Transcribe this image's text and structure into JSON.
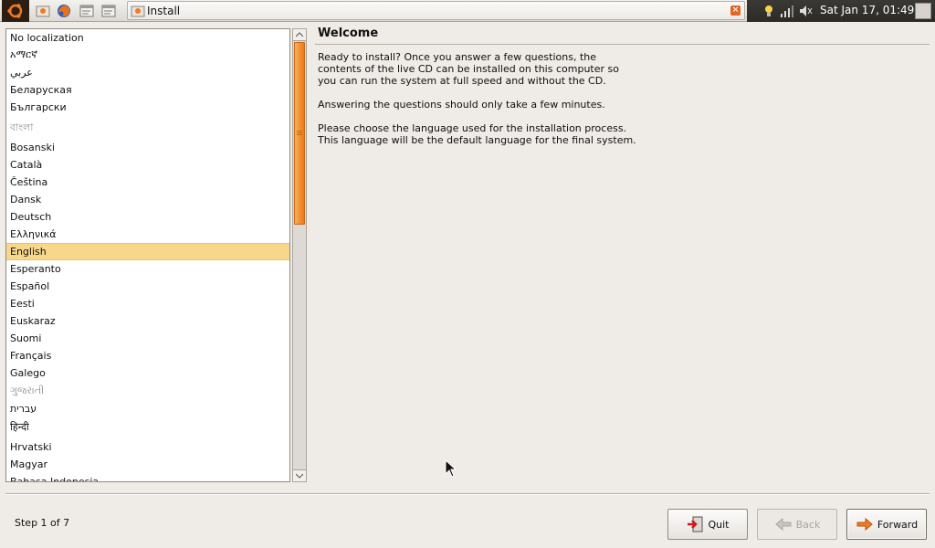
{
  "panel": {
    "window_title": "Install",
    "clock": "Sat Jan 17, 01:49"
  },
  "languages": [
    "No localization",
    "አማርኛ",
    "عربي",
    "Беларуская",
    "Български",
    "বাংলা",
    "Bosanski",
    "Català",
    "Čeština",
    "Dansk",
    "Deutsch",
    "Ελληνικά",
    "English",
    "Esperanto",
    "Español",
    "Eesti",
    "Euskaraz",
    "Suomi",
    "Français",
    "Galego",
    "ગુજરાતી",
    "עברית",
    "हिन्दी",
    "Hrvatski",
    "Magyar",
    "Bahasa Indonesia"
  ],
  "selected_language": "English",
  "welcome": {
    "title": "Welcome",
    "paragraph1": "Ready to install? Once you answer a few questions, the\ncontents of the live CD can be installed on this computer so\nyou can run the system at full speed and without the CD.",
    "paragraph2": "Answering the questions should only take a few minutes.",
    "paragraph3": "Please choose the language used for the installation process.\nThis language will be the default language for the final system."
  },
  "footer": {
    "step": "Step 1 of 7",
    "quit_label": "Quit",
    "back_label": "Back",
    "forward_label": "Forward"
  },
  "colors": {
    "selection": "#f8d78b",
    "scroll_thumb": "#f38d2d",
    "panel_dark": "#2b2a27"
  }
}
